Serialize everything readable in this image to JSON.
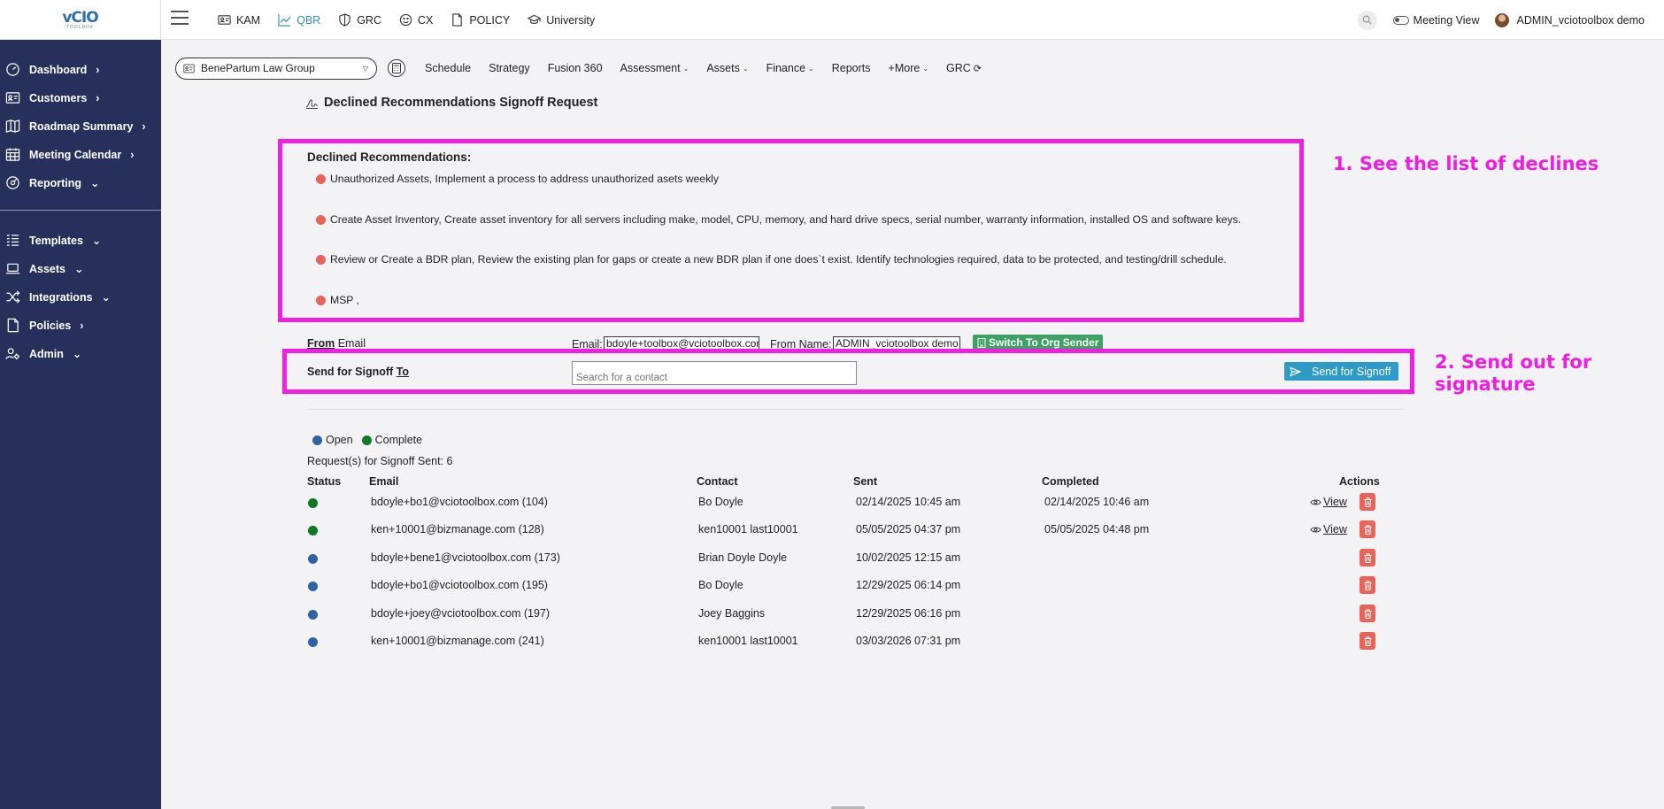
{
  "app": {
    "logo_text": "vCIO",
    "logo_sub": "TOOLBOX"
  },
  "topnav": [
    {
      "label": "KAM",
      "icon": "id-card-icon"
    },
    {
      "label": "QBR",
      "icon": "line-chart-icon"
    },
    {
      "label": "GRC",
      "icon": "shield-icon"
    },
    {
      "label": "CX",
      "icon": "smile-icon"
    },
    {
      "label": "POLICY",
      "icon": "document-icon"
    },
    {
      "label": "University",
      "icon": "graduation-cap-icon"
    }
  ],
  "header_right": {
    "meeting_view": "Meeting View",
    "user": "ADMIN_vciotoolbox demo"
  },
  "sidebar": {
    "items": [
      {
        "label": "Dashboard",
        "chev": "›"
      },
      {
        "label": "Customers",
        "chev": "›"
      },
      {
        "label": "Roadmap Summary",
        "chev": "›"
      },
      {
        "label": "Meeting Calendar",
        "chev": "›"
      },
      {
        "label": "Reporting",
        "chev": "⌄"
      },
      {
        "label": "Templates",
        "chev": "⌄"
      },
      {
        "label": "Assets",
        "chev": "⌄"
      },
      {
        "label": "Integrations",
        "chev": "⌄"
      },
      {
        "label": "Policies",
        "chev": "›"
      },
      {
        "label": "Admin",
        "chev": "⌄"
      }
    ]
  },
  "subbar": {
    "org": "BenePartum Law Group",
    "items": [
      {
        "label": "Schedule",
        "dd": ""
      },
      {
        "label": "Strategy",
        "dd": ""
      },
      {
        "label": "Fusion 360",
        "dd": ""
      },
      {
        "label": "Assessment",
        "dd": "⌄"
      },
      {
        "label": "Assets",
        "dd": "⌄"
      },
      {
        "label": "Finance",
        "dd": "⌄"
      },
      {
        "label": "Reports",
        "dd": ""
      },
      {
        "label": "+More",
        "dd": "⌄"
      },
      {
        "label": "GRC",
        "dd": "⟳"
      }
    ]
  },
  "page": {
    "title": "Declined Recommendations Signoff Request"
  },
  "declines": {
    "title": "Declined Recommendations:",
    "items": [
      "Unauthorized Assets, Implement a process to address unauthorized asets weekly",
      "Create Asset Inventory, Create asset inventory for all servers including make, model, CPU, memory, and hard drive specs, serial number, warranty information, installed OS and software keys.",
      "Review or Create a BDR plan, Review the existing plan for gaps or create a new BDR plan if one does`t exist. Identify technologies required, data to be protected, and testing/drill schedule.",
      "MSP ,"
    ]
  },
  "annotations": {
    "a1": "1. See the list of declines",
    "a2_line1": "2. Send out for",
    "a2_line2": "signature"
  },
  "from": {
    "label_strong": "From",
    "label_rest": " Email",
    "email_label": "Email:",
    "email_value": "bdoyle+toolbox@vciotoolbox.com",
    "name_label": "From Name:",
    "name_value": "ADMIN_vciotoolbox demo",
    "switch_label": "Switch To Org Sender"
  },
  "send": {
    "label_strong": "Send for Signoff ",
    "label_to": "To",
    "contact_placeholder": "Search for a contact",
    "button_label": "Send for Signoff"
  },
  "legend": {
    "open": "Open",
    "complete": "Complete"
  },
  "requests": {
    "count_text": "Request(s) for Signoff Sent: 6",
    "headers": {
      "status": "Status",
      "email": "Email",
      "contact": "Contact",
      "sent": "Sent",
      "completed": "Completed",
      "actions": "Actions"
    },
    "rows": [
      {
        "status": "complete",
        "email": "bdoyle+bo1@vciotoolbox.com (104)",
        "contact": "Bo Doyle",
        "sent": "02/14/2025 10:45 am",
        "completed": "02/14/2025 10:46 am",
        "view": "View"
      },
      {
        "status": "complete",
        "email": "ken+10001@bizmanage.com (128)",
        "contact": "ken10001 last10001",
        "sent": "05/05/2025 04:37 pm",
        "completed": "05/05/2025 04:48 pm",
        "view": "View"
      },
      {
        "status": "open",
        "email": "bdoyle+bene1@vciotoolbox.com (173)",
        "contact": "Brian Doyle Doyle",
        "sent": "10/02/2025 12:15 am",
        "completed": "",
        "view": ""
      },
      {
        "status": "open",
        "email": "bdoyle+bo1@vciotoolbox.com (195)",
        "contact": "Bo Doyle",
        "sent": "12/29/2025 06:14 pm",
        "completed": "",
        "view": ""
      },
      {
        "status": "open",
        "email": "bdoyle+joey@vciotoolbox.com (197)",
        "contact": "Joey Baggins",
        "sent": "12/29/2025 06:16 pm",
        "completed": "",
        "view": ""
      },
      {
        "status": "open",
        "email": "ken+10001@bizmanage.com (241)",
        "contact": "ken10001 last10001",
        "sent": "03/03/2026 07:31 pm",
        "completed": "",
        "view": ""
      }
    ]
  },
  "colors": {
    "sidebar": "#27305a",
    "accent": "#2f8fb8",
    "highlight": "#f21ee0",
    "open": "#2f62a6",
    "complete": "#0c7a24",
    "danger": "#e8645b"
  }
}
